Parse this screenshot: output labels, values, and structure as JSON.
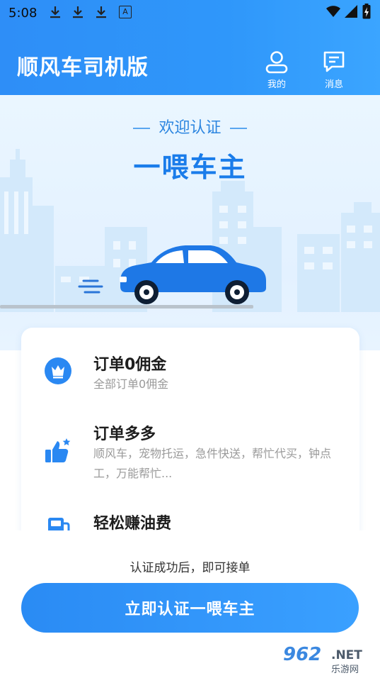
{
  "status_bar": {
    "time": "5:08",
    "notification_icons": [
      "download-icon",
      "download-icon",
      "download-icon",
      "translate-icon"
    ],
    "system_icons": [
      "wifi-icon",
      "signal-icon",
      "battery-charging-icon"
    ]
  },
  "header": {
    "title": "顺风车司机版",
    "mine_label": "我的",
    "messages_label": "消息",
    "gradient_color": "#2E8EF7"
  },
  "hero": {
    "welcome": "欢迎认证",
    "title": "一喂车主",
    "car_color": "#1E78E6"
  },
  "features": [
    {
      "icon": "crown-icon",
      "title": "订单0佣金",
      "desc": "全部订单0佣金"
    },
    {
      "icon": "thumbs-up-icon",
      "title": "订单多多",
      "desc": "顺风车，宠物托运，急件快送，帮忙代买，钟点工，万能帮忙..."
    },
    {
      "icon": "fuel-icon",
      "title": "轻松赚油费",
      "desc": ""
    }
  ],
  "bottom": {
    "hint": "认证成功后，即可接单",
    "cta_label": "立即认证一喂车主"
  },
  "watermark": {
    "brand": "962",
    "net": ".NET",
    "site": "乐游网"
  }
}
